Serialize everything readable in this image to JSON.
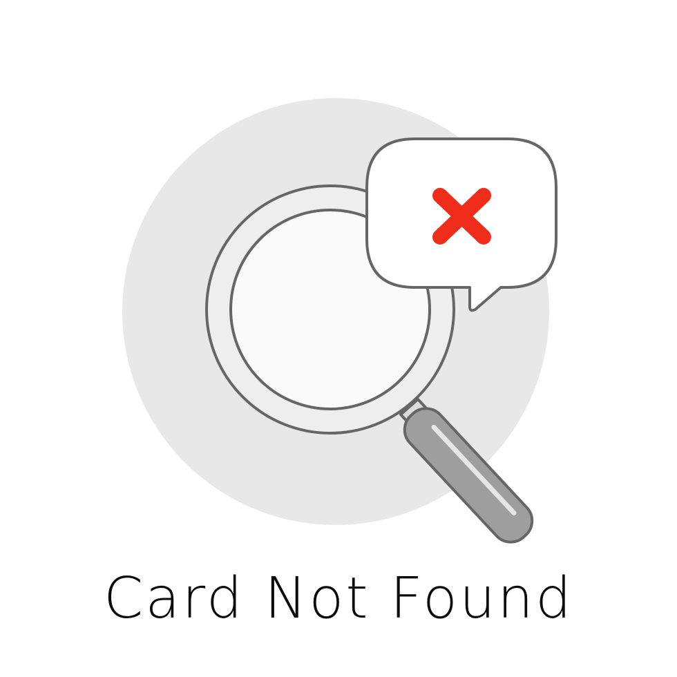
{
  "caption": {
    "text": "Card Not Found"
  },
  "illustration": {
    "main_icon": "magnifying-glass-icon",
    "status_icon": "error-x-icon",
    "colors": {
      "background_circle": "#e8e8e8",
      "lens_fill": "#fafafa",
      "frame_fill": "#eeeeee",
      "outline": "#666666",
      "handle": "#9e9e9e",
      "bubble_fill": "#ffffff",
      "error_red": "#f02d1a"
    }
  }
}
